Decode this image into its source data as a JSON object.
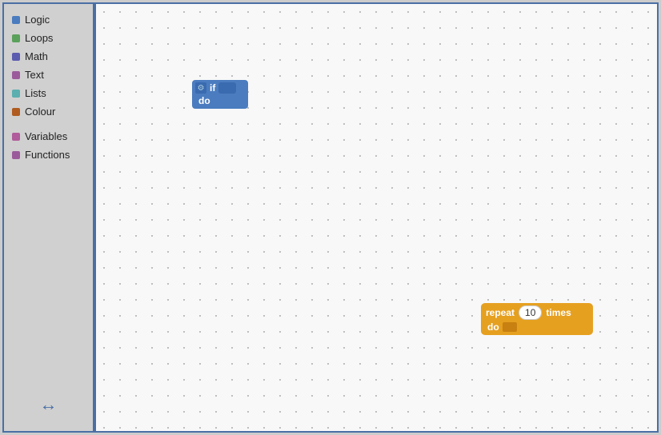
{
  "sidebar": {
    "items": [
      {
        "id": "logic",
        "label": "Logic",
        "color": "#4a7cbf"
      },
      {
        "id": "loops",
        "label": "Loops",
        "color": "#5ba05b"
      },
      {
        "id": "math",
        "label": "Math",
        "color": "#5b5baf"
      },
      {
        "id": "text",
        "label": "Text",
        "color": "#9b5b9b"
      },
      {
        "id": "lists",
        "label": "Lists",
        "color": "#5bafaf"
      },
      {
        "id": "colour",
        "label": "Colour",
        "color": "#b05b20"
      },
      {
        "id": "variables",
        "label": "Variables",
        "color": "#b05b9b"
      },
      {
        "id": "functions",
        "label": "Functions",
        "color": "#9b5b9b"
      }
    ],
    "resize_arrow": "↔"
  },
  "canvas": {
    "blocks": {
      "if_block": {
        "if_label": "if",
        "do_label": "do"
      },
      "repeat_block": {
        "repeat_label": "repeat",
        "number": "10",
        "times_label": "times",
        "do_label": "do"
      }
    }
  }
}
